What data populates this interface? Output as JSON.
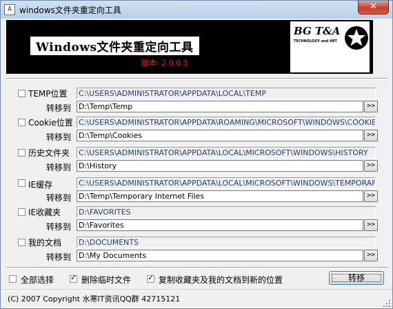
{
  "window": {
    "title": "windows文件夹重定向工具",
    "close_label": "✕"
  },
  "banner": {
    "title": "Windows文件夹重定向工具",
    "version": "版本: 2.0.0.3",
    "logo_text": "BG T&A",
    "logo_sub": "TECHNOLOGY and ART"
  },
  "common": {
    "move_to_label": "转移到",
    "browse_label": ">>"
  },
  "rows": [
    {
      "label": "TEMP位置",
      "checked": false,
      "source": "C:\\USERS\\ADMINISTRATOR\\APPDATA\\LOCAL\\TEMP",
      "target": "D:\\Temp\\Temp"
    },
    {
      "label": "Cookie位置",
      "checked": false,
      "source": "C:\\USERS\\ADMINISTRATOR\\APPDATA\\ROAMING\\MICROSOFT\\WINDOWS\\COOKIE",
      "target": "D:\\Temp\\Cookies"
    },
    {
      "label": "历史文件夹",
      "checked": false,
      "source": "C:\\USERS\\ADMINISTRATOR\\APPDATA\\LOCAL\\MICROSOFT\\WINDOWS\\HISTORY",
      "target": "D:\\History"
    },
    {
      "label": "IE缓存",
      "checked": false,
      "source": "C:\\USERS\\ADMINISTRATOR\\APPDATA\\LOCAL\\MICROSOFT\\WINDOWS\\TEMPORAF",
      "target": "D:\\Temp\\Temporary Internet Files"
    },
    {
      "label": "IE收藏夹",
      "checked": false,
      "source": "D:\\FAVORITES",
      "target": "D:\\Favorites"
    },
    {
      "label": "我的文档",
      "checked": false,
      "source": "D:\\DOCUMENTS",
      "target": "D:\\My Documents"
    }
  ],
  "options": {
    "select_all": {
      "label": "全部选择",
      "checked": false
    },
    "delete_temp": {
      "label": "删除临时文件",
      "checked": true
    },
    "copy_favorites": {
      "label": "复制收藏夹及我的文档到新的位置",
      "checked": true
    }
  },
  "move_button": "转移",
  "status": "(C) 2007 Copyright 水寒IT资讯QQ群 42715121"
}
